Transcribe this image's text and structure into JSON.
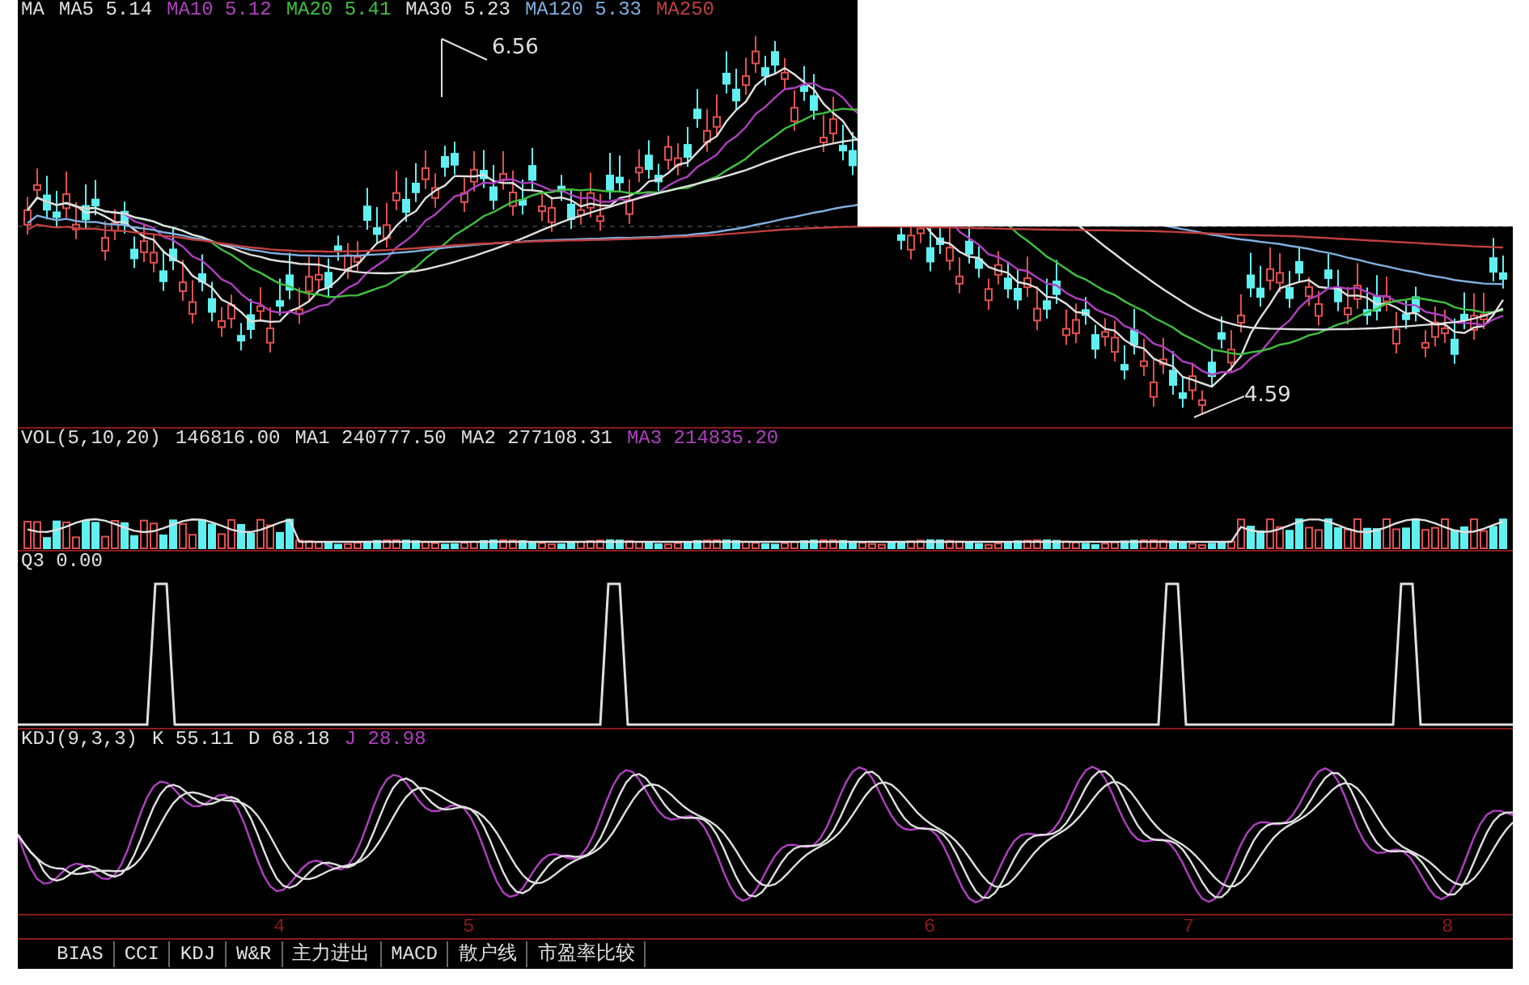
{
  "main_chart": {
    "legend": [
      {
        "label": "MA",
        "color": "#e0e0e0"
      },
      {
        "label": "MA5 5.14",
        "color": "#e0e0e0"
      },
      {
        "label": "MA10 5.12",
        "color": "#b040c0"
      },
      {
        "label": "MA20 5.41",
        "color": "#40c040"
      },
      {
        "label": "MA30 5.23",
        "color": "#e0e0e0"
      },
      {
        "label": "MA120 5.33",
        "color": "#80b0e0"
      },
      {
        "label": "MA250",
        "color": "#c04040"
      }
    ],
    "high_label": "6.56",
    "low_label": "4.59"
  },
  "volume": {
    "legend": [
      {
        "label": "VOL(5,10,20)",
        "color": "#e0e0e0"
      },
      {
        "label": "146816.00",
        "color": "#e0e0e0"
      },
      {
        "label": "MA1 240777.50",
        "color": "#e0e0e0"
      },
      {
        "label": "MA2 277108.31",
        "color": "#e0e0e0"
      },
      {
        "label": "MA3 214835.20",
        "color": "#b040c0"
      }
    ]
  },
  "q3": {
    "legend": [
      {
        "label": "Q3 0.00",
        "color": "#e0e0e0"
      }
    ]
  },
  "kdj": {
    "legend": [
      {
        "label": "KDJ(9,3,3)",
        "color": "#e0e0e0"
      },
      {
        "label": "K 55.11",
        "color": "#e0e0e0"
      },
      {
        "label": "D 68.18",
        "color": "#e0e0e0"
      },
      {
        "label": "J 28.98",
        "color": "#b040c0"
      }
    ]
  },
  "x_axis": [
    "4",
    "5",
    "6",
    "7",
    "8"
  ],
  "tabs": [
    {
      "label": "BIAS",
      "selected": false
    },
    {
      "label": "CCI",
      "selected": false
    },
    {
      "label": "KDJ",
      "selected": false
    },
    {
      "label": "W&R",
      "selected": false
    },
    {
      "label": "主力进出",
      "selected": false
    },
    {
      "label": "MACD",
      "selected": false
    },
    {
      "label": "散户线",
      "selected": false
    },
    {
      "label": "市盈率比较",
      "selected": false
    }
  ]
}
